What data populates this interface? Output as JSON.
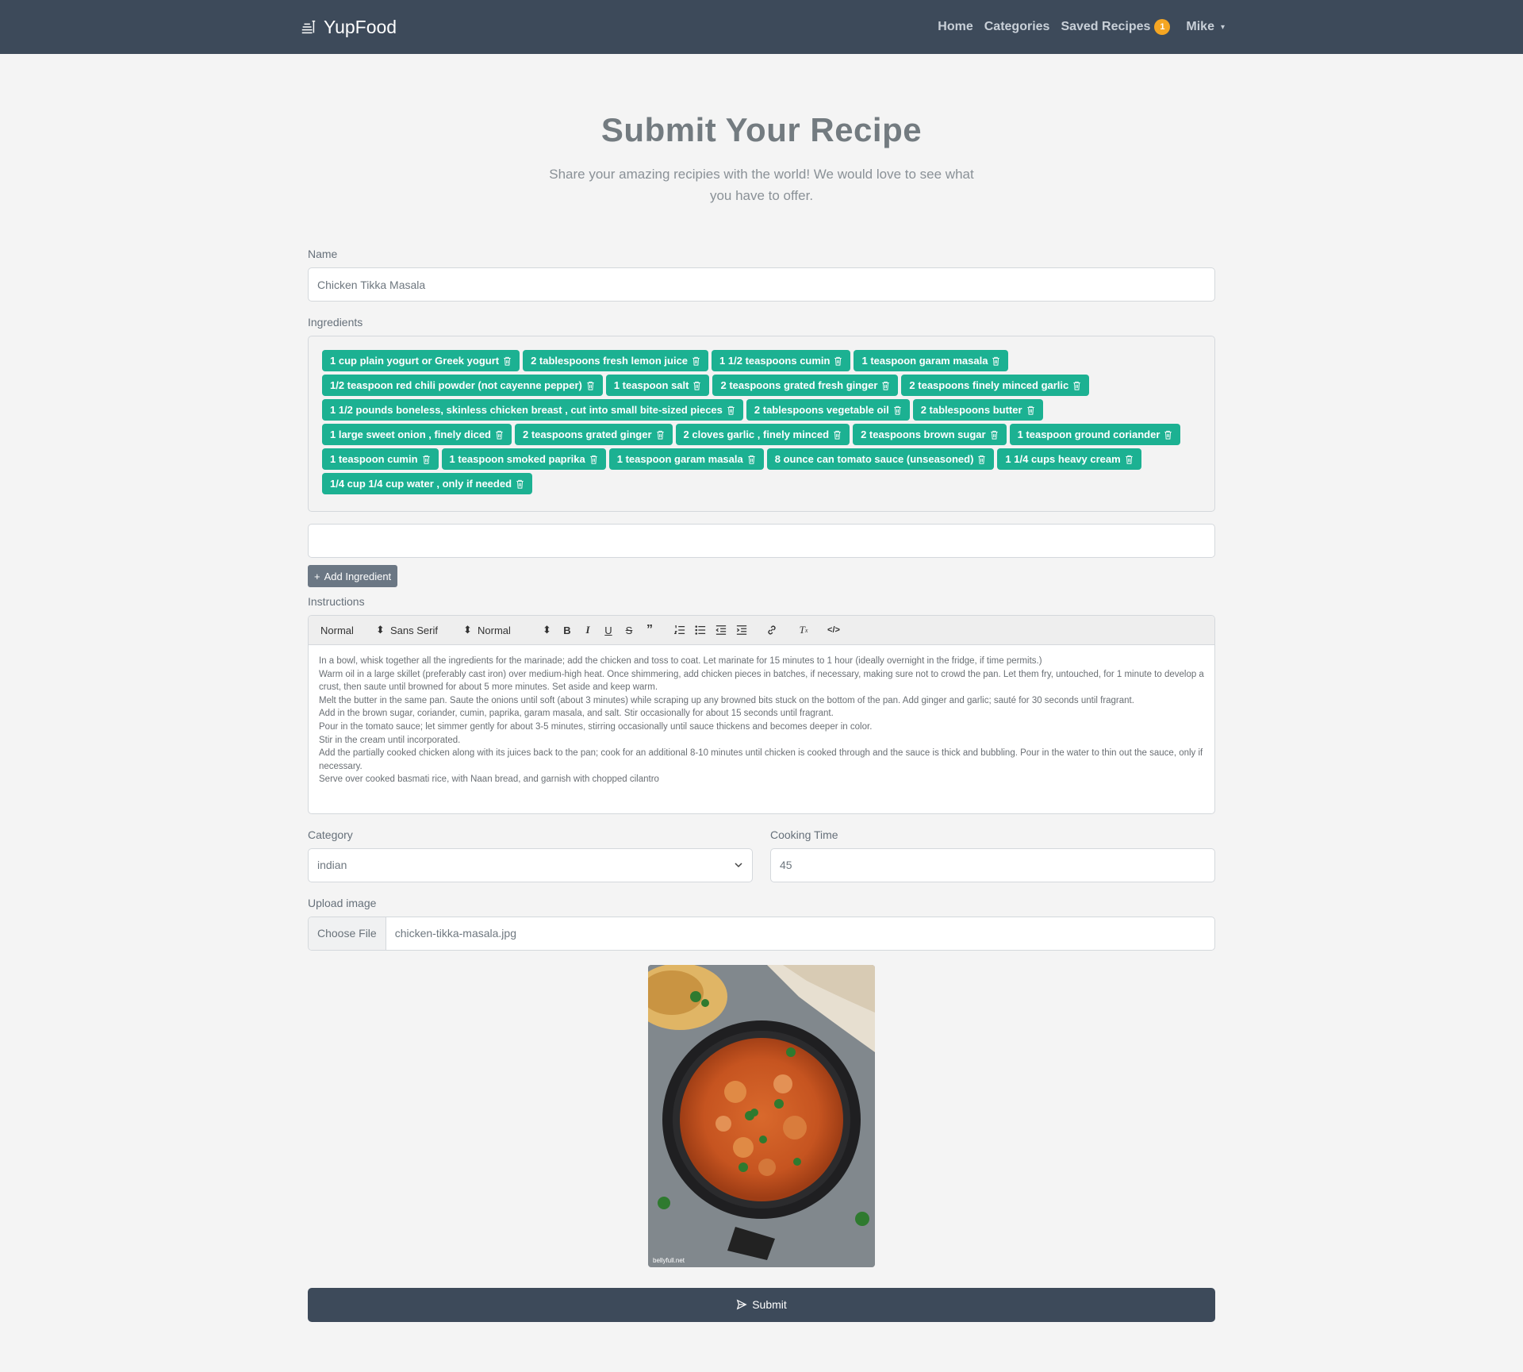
{
  "nav": {
    "brand": "YupFood",
    "links": [
      "Home",
      "Categories",
      "Saved Recipes"
    ],
    "saved_count": "1",
    "user": "Mike"
  },
  "hero": {
    "title": "Submit Your Recipe",
    "subtitle": "Share your amazing recipies with the world! We would love to see what you have to offer."
  },
  "form": {
    "name_label": "Name",
    "name_value": "Chicken Tikka Masala",
    "ingredients_label": "Ingredients",
    "ingredients": [
      "1 cup plain yogurt or Greek yogurt",
      "2 tablespoons fresh lemon juice",
      "1 1/2 teaspoons cumin",
      "1 teaspoon garam masala",
      "1/2 teaspoon red chili powder (not cayenne pepper)",
      "1 teaspoon salt",
      "2 teaspoons grated fresh ginger",
      "2 teaspoons finely minced garlic",
      "1 1/2 pounds boneless, skinless chicken breast , cut into small bite-sized pieces",
      "2 tablespoons vegetable oil",
      "2 tablespoons butter",
      "1 large sweet onion , finely diced",
      "2 teaspoons grated ginger",
      "2 cloves garlic , finely minced",
      "2 teaspoons brown sugar",
      "1 teaspoon ground coriander",
      "1 teaspoon cumin",
      "1 teaspoon smoked paprika",
      "1 teaspoon garam masala",
      "8 ounce can tomato sauce (unseasoned)",
      "1 1/4 cups heavy cream",
      "1/4 cup 1/4 cup water , only if needed"
    ],
    "new_ingredient_value": "",
    "add_ingredient_label": "Add Ingredient",
    "instructions_label": "Instructions",
    "toolbar": {
      "heading": "Normal",
      "font": "Sans Serif",
      "size": "Normal"
    },
    "instructions": [
      "In a bowl, whisk together all the ingredients for the marinade; add the chicken and toss to coat. Let marinate for 15 minutes to 1 hour (ideally overnight in the fridge, if time permits.)",
      "Warm oil in a large skillet (preferably cast iron) over medium-high heat. Once shimmering, add chicken pieces in batches, if necessary, making sure not to crowd the pan. Let them fry, untouched, for 1 minute to develop a crust, then saute until browned for about 5 more minutes. Set aside and keep warm.",
      "Melt the butter in the same pan. Saute the onions until soft (about 3 minutes) while scraping up any browned bits stuck on the bottom of the pan. Add ginger and garlic; sauté for 30 seconds until fragrant.",
      "Add in the brown sugar, coriander, cumin, paprika, garam masala, and salt. Stir occasionally for about 15 seconds until fragrant.",
      "Pour in the tomato sauce; let simmer gently for about 3-5 minutes, stirring occasionally until sauce thickens and becomes deeper in color.",
      "Stir in the cream until incorporated.",
      "Add the partially cooked chicken along with its juices back to the pan; cook for an additional 8-10 minutes until chicken is cooked through and the sauce is thick and bubbling. Pour in the water to thin out the sauce, only if necessary.",
      "Serve over cooked basmati rice, with Naan bread, and garnish with chopped cilantro"
    ],
    "category_label": "Category",
    "category_value": "indian",
    "cooking_time_label": "Cooking Time",
    "cooking_time_value": "45",
    "upload_label": "Upload image",
    "choose_file_label": "Choose File",
    "file_name": "chicken-tikka-masala.jpg",
    "image_watermark": "bellyfull.net",
    "submit_label": "Submit"
  },
  "colors": {
    "navbar": "#3d4a5a",
    "chip": "#1cb192",
    "badge": "#f5a623",
    "add_button": "#6b7784"
  }
}
